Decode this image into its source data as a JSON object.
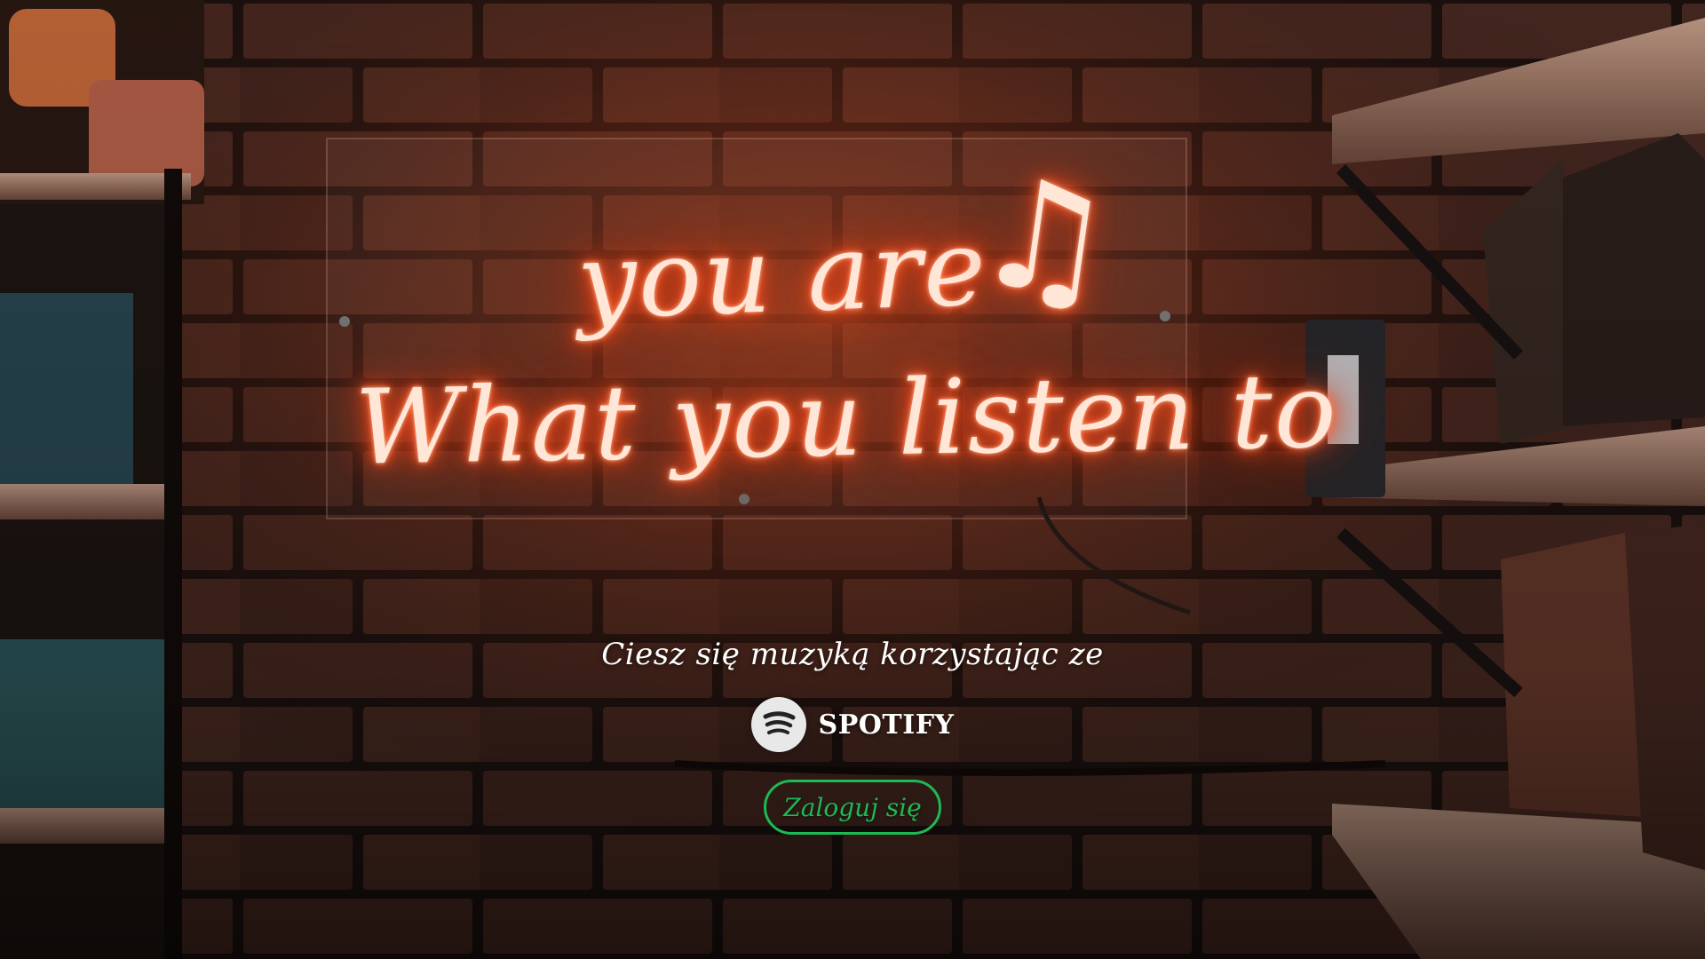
{
  "background": {
    "description_icon": "neon-sign-brick-wall-photo"
  },
  "neon_sign": {
    "line1": "you are",
    "line2": "What you listen to",
    "note_glyph": "♫",
    "note_icon": "music-note-icon"
  },
  "login": {
    "tagline": "Ciesz się muzyką korzystając ze",
    "brand_name": "SPOTIFY",
    "brand_icon": "spotify-logo-icon",
    "login_button_label": "Zaloguj się"
  },
  "colors": {
    "accent": "#1db954",
    "neon": "#ff5a2a",
    "brick": "#5a2f26"
  }
}
